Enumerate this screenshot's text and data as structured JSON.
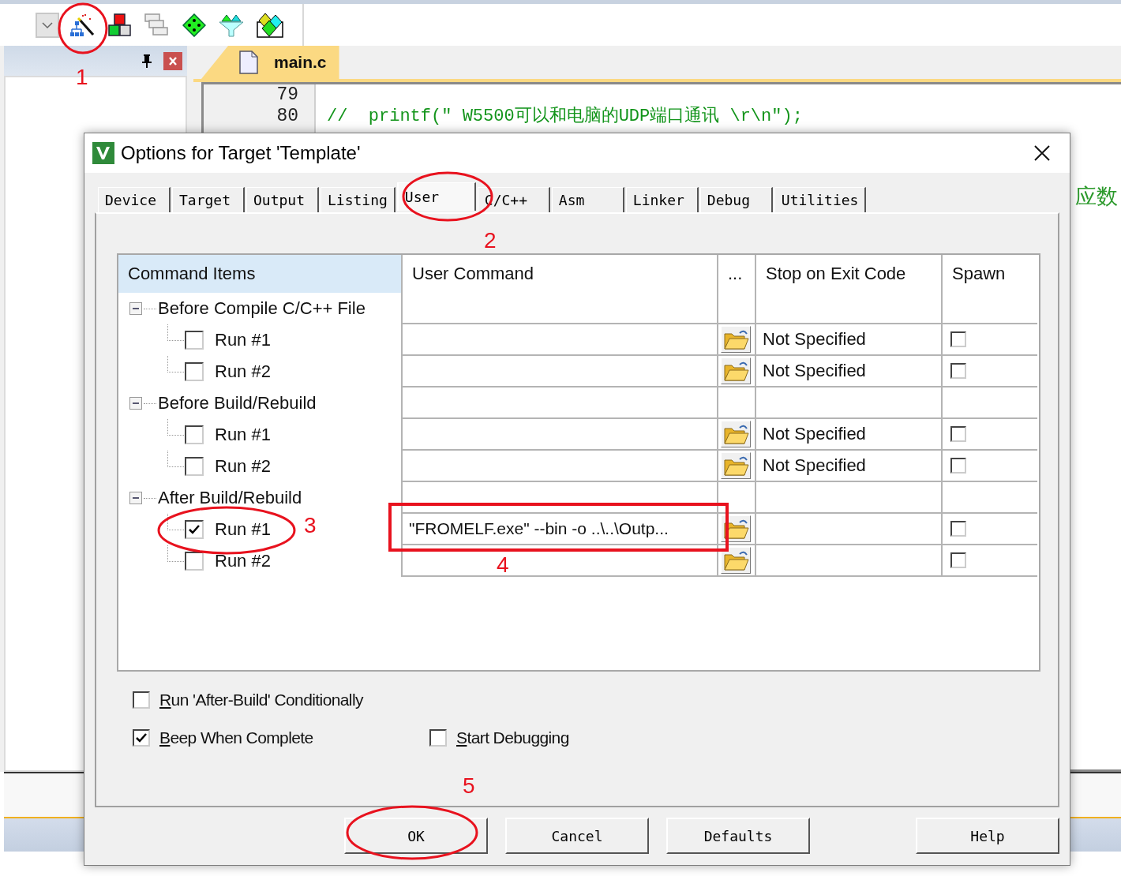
{
  "editor": {
    "tab": {
      "label": "main.c",
      "selected": true
    },
    "lines": [
      {
        "number": "79"
      },
      {
        "number": "80",
        "code": "//  printf(\" W5500可以和电脑的UDP端口通讯 \\r\\n\");"
      }
    ],
    "side_text": "应数"
  },
  "dialog": {
    "title": "Options for Target 'Template'",
    "tabs": [
      {
        "label": "Device",
        "selected": false
      },
      {
        "label": "Target",
        "selected": false
      },
      {
        "label": "Output",
        "selected": false
      },
      {
        "label": "Listing",
        "selected": false
      },
      {
        "label": "User",
        "selected": true
      },
      {
        "label": "C/C++",
        "selected": false
      },
      {
        "label": "Asm",
        "selected": false
      },
      {
        "label": "Linker",
        "selected": false
      },
      {
        "label": "Debug",
        "selected": false
      },
      {
        "label": "Utilities",
        "selected": false
      }
    ],
    "table": {
      "columns": [
        "Command Items",
        "User Command",
        "...",
        "Stop on Exit Code",
        "Spawn"
      ],
      "groups": [
        {
          "label": "Before Compile C/C++ File",
          "expanded": true,
          "children": [
            {
              "label": "Run #1",
              "checked": false,
              "stop_code": "Not Specified",
              "spawn": false
            },
            {
              "label": "Run #2",
              "checked": false,
              "stop_code": "Not Specified",
              "spawn": false
            }
          ]
        },
        {
          "label": "Before Build/Rebuild",
          "expanded": true,
          "children": [
            {
              "label": "Run #1",
              "checked": false,
              "stop_code": "Not Specified",
              "spawn": false
            },
            {
              "label": "Run #2",
              "checked": false,
              "stop_code": "Not Specified",
              "spawn": false
            }
          ]
        },
        {
          "label": "After Build/Rebuild",
          "expanded": true,
          "children": [
            {
              "label": "Run #1",
              "checked": true,
              "command": "\"FROMELF.exe\"  --bin -o  ..\\..\\Outp...",
              "spawn": false
            },
            {
              "label": "Run #2",
              "checked": false,
              "spawn": false
            }
          ]
        }
      ]
    },
    "options": [
      {
        "label": "Run 'After-Build' Conditionally",
        "checked": false
      },
      {
        "label": "Beep When Complete",
        "checked": true
      },
      {
        "label": "Start Debugging",
        "checked": false
      }
    ],
    "buttons": [
      "OK",
      "Cancel",
      "Defaults",
      "Help"
    ]
  },
  "annotations": [
    {
      "label": "1",
      "kind": "ellipse"
    },
    {
      "label": "2",
      "kind": "ellipse"
    },
    {
      "label": "3",
      "kind": "ellipse"
    },
    {
      "label": "4",
      "kind": "box"
    },
    {
      "label": "5",
      "kind": "ellipse"
    }
  ]
}
